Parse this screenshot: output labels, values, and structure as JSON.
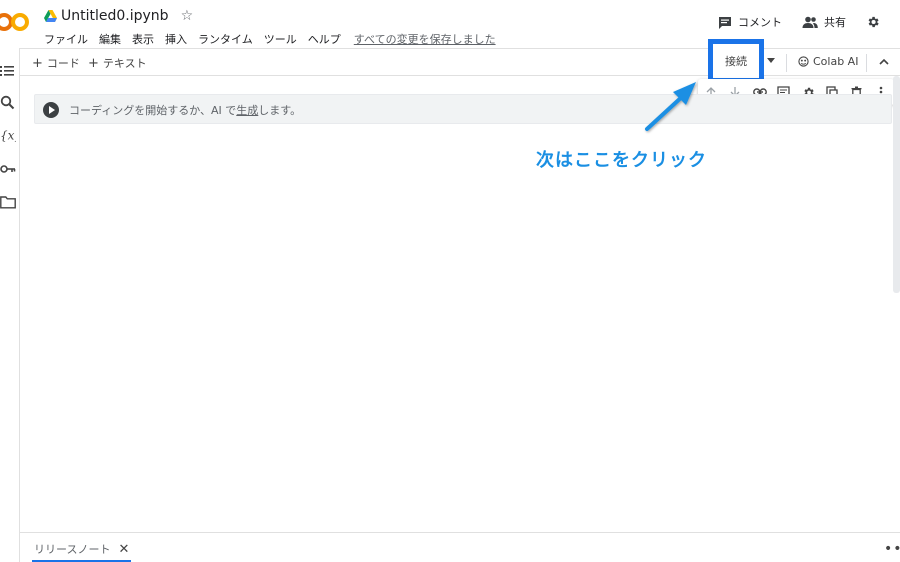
{
  "header": {
    "title": "Untitled0.ipynb",
    "menu": [
      "ファイル",
      "編集",
      "表示",
      "挿入",
      "ランタイム",
      "ツール",
      "ヘルプ"
    ],
    "save_status": "すべての変更を保存しました",
    "comment_label": "コメント",
    "share_label": "共有"
  },
  "toolbar": {
    "add_code": "コード",
    "add_text": "テキスト",
    "connect_label": "接続",
    "colab_ai_label": "Colab AI"
  },
  "cell": {
    "placeholder_before": "コーディングを開始するか、AI で",
    "placeholder_link": "生成",
    "placeholder_after": "します。"
  },
  "annotation": {
    "text": "次はここをクリック",
    "color": "#1a8fe3"
  },
  "bottom": {
    "tab_label": "リリースノート"
  },
  "colors": {
    "highlight": "#1a73e8",
    "logo_orange": "#f9ab00",
    "logo_dark_orange": "#e8710a"
  },
  "icons": {
    "sidebar": [
      "toc-icon",
      "search-icon",
      "variables-icon",
      "key-icon",
      "folder-icon"
    ],
    "cell_toolbar": [
      "arrow-up-icon",
      "arrow-down-icon",
      "link-icon",
      "comment-icon",
      "gear-icon",
      "mirror-icon",
      "trash-icon",
      "more-vert-icon"
    ]
  }
}
